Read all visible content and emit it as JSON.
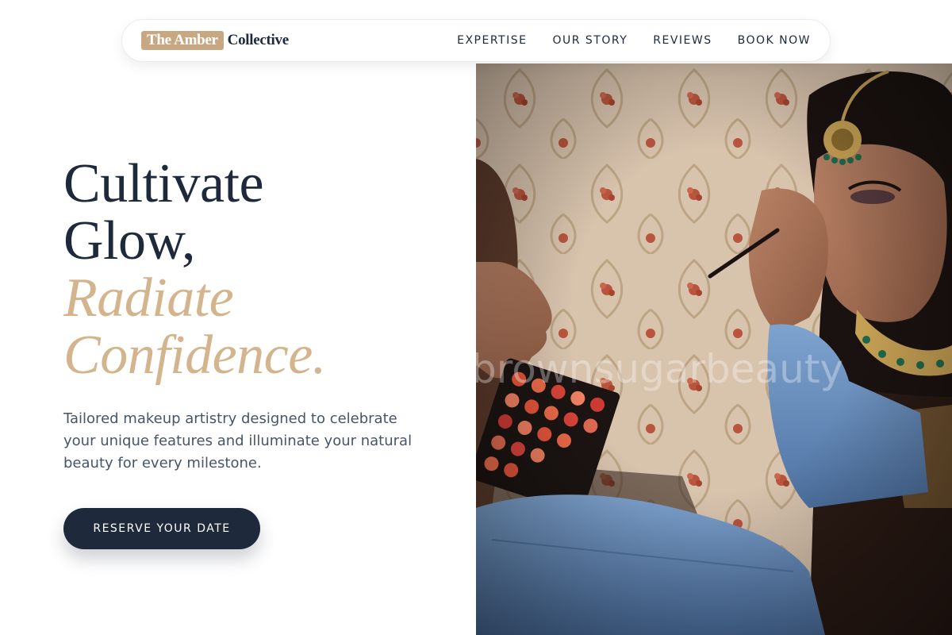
{
  "brand": {
    "highlight": "The Amber",
    "rest": "Collective"
  },
  "nav": {
    "items": [
      {
        "label": "EXPERTISE"
      },
      {
        "label": "OUR STORY"
      },
      {
        "label": "REVIEWS"
      },
      {
        "label": "BOOK NOW"
      }
    ]
  },
  "hero": {
    "headline": {
      "line1": "Cultivate",
      "line2": "Glow,",
      "accent1": "Radiate",
      "accent2": "Confidence."
    },
    "tagline": "Tailored makeup artistry designed to celebrate your unique features and illuminate your natural beauty for every milestone.",
    "cta_label": "RESERVE YOUR DATE",
    "image_watermark": "brownsugarbeauty"
  },
  "colors": {
    "accent": "#c8a882",
    "heading_accent": "#d4b48c",
    "navy": "#1e293b",
    "body_text": "#475569"
  }
}
